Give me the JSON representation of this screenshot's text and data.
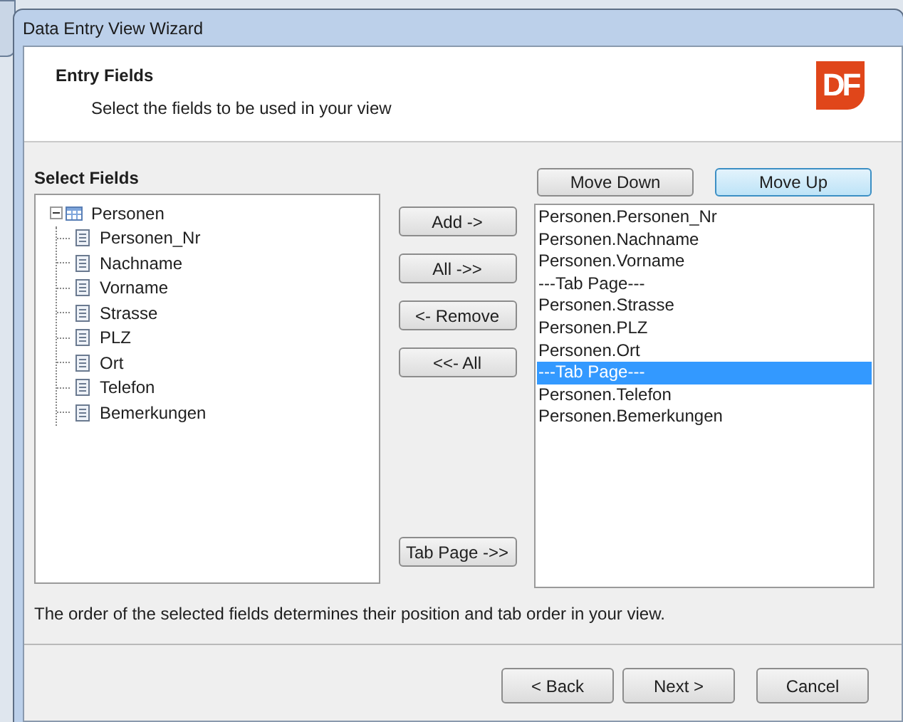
{
  "window": {
    "title": "Data Entry View Wizard"
  },
  "header": {
    "title": "Entry Fields",
    "subtitle": "Select the fields to be used in your view",
    "logo": "DF"
  },
  "select_fields": {
    "label": "Select Fields",
    "tree": [
      {
        "label": "Personen",
        "kind": "table",
        "expanded": true,
        "children": [
          {
            "label": "Personen_Nr",
            "kind": "field"
          },
          {
            "label": "Nachname",
            "kind": "field"
          },
          {
            "label": "Vorname",
            "kind": "field"
          },
          {
            "label": "Strasse",
            "kind": "field"
          },
          {
            "label": "PLZ",
            "kind": "field"
          },
          {
            "label": "Ort",
            "kind": "field"
          },
          {
            "label": "Telefon",
            "kind": "field"
          },
          {
            "label": "Bemerkungen",
            "kind": "field"
          }
        ]
      }
    ]
  },
  "transfer_buttons": [
    "Add ->",
    "All ->>",
    "<- Remove",
    "<<- All"
  ],
  "tab_page_button": "Tab Page ->>",
  "order_buttons": [
    {
      "label": "Move Down",
      "focused": false
    },
    {
      "label": "Move Up",
      "focused": true
    }
  ],
  "selected_fields": [
    {
      "label": "Personen.Personen_Nr",
      "selected": false
    },
    {
      "label": "Personen.Nachname",
      "selected": false
    },
    {
      "label": "Personen.Vorname",
      "selected": false
    },
    {
      "label": "---Tab Page---",
      "selected": false
    },
    {
      "label": "Personen.Strasse",
      "selected": false
    },
    {
      "label": "Personen.PLZ",
      "selected": false
    },
    {
      "label": "Personen.Ort",
      "selected": false
    },
    {
      "label": "---Tab Page---",
      "selected": true
    },
    {
      "label": "Personen.Telefon",
      "selected": false
    },
    {
      "label": "Personen.Bemerkungen",
      "selected": false
    }
  ],
  "hint": "The order of the selected fields determines their position and tab order in your view.",
  "nav_buttons": [
    "< Back",
    "Next >",
    "Cancel"
  ]
}
